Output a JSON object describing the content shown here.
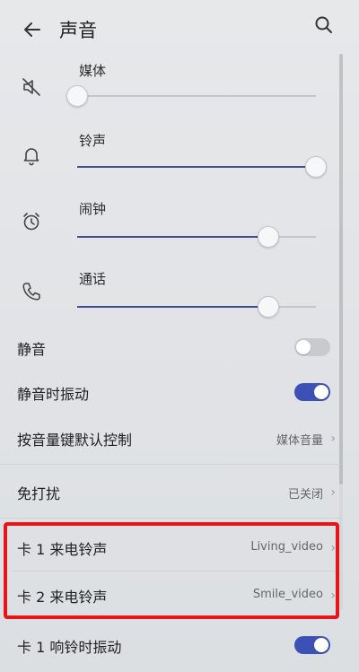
{
  "header": {
    "title": "声音"
  },
  "volumes": [
    {
      "label": "媒体",
      "level": 0.0,
      "icon": "speaker-muted-icon"
    },
    {
      "label": "铃声",
      "level": 1.0,
      "icon": "bell-icon"
    },
    {
      "label": "闹钟",
      "level": 0.8,
      "icon": "alarm-clock-icon"
    },
    {
      "label": "通话",
      "level": 0.8,
      "icon": "phone-icon"
    }
  ],
  "settings": {
    "mute": {
      "label": "静音",
      "state": "off"
    },
    "vibrate_mute": {
      "label": "静音时振动",
      "state": "on"
    },
    "volume_key": {
      "label": "按音量键默认控制",
      "value": "媒体音量"
    },
    "dnd": {
      "label": "免打扰",
      "value": "已关闭"
    },
    "sim1_ringtone": {
      "label": "卡 1 来电铃声",
      "value": "Living_video"
    },
    "sim2_ringtone": {
      "label": "卡 2 来电铃声",
      "value": "Smile_video"
    },
    "sim1_vibrate": {
      "label": "卡 1 响铃时振动",
      "state": "on"
    }
  },
  "colors": {
    "accent": "#3b51b5",
    "highlight": "#e8141a"
  }
}
